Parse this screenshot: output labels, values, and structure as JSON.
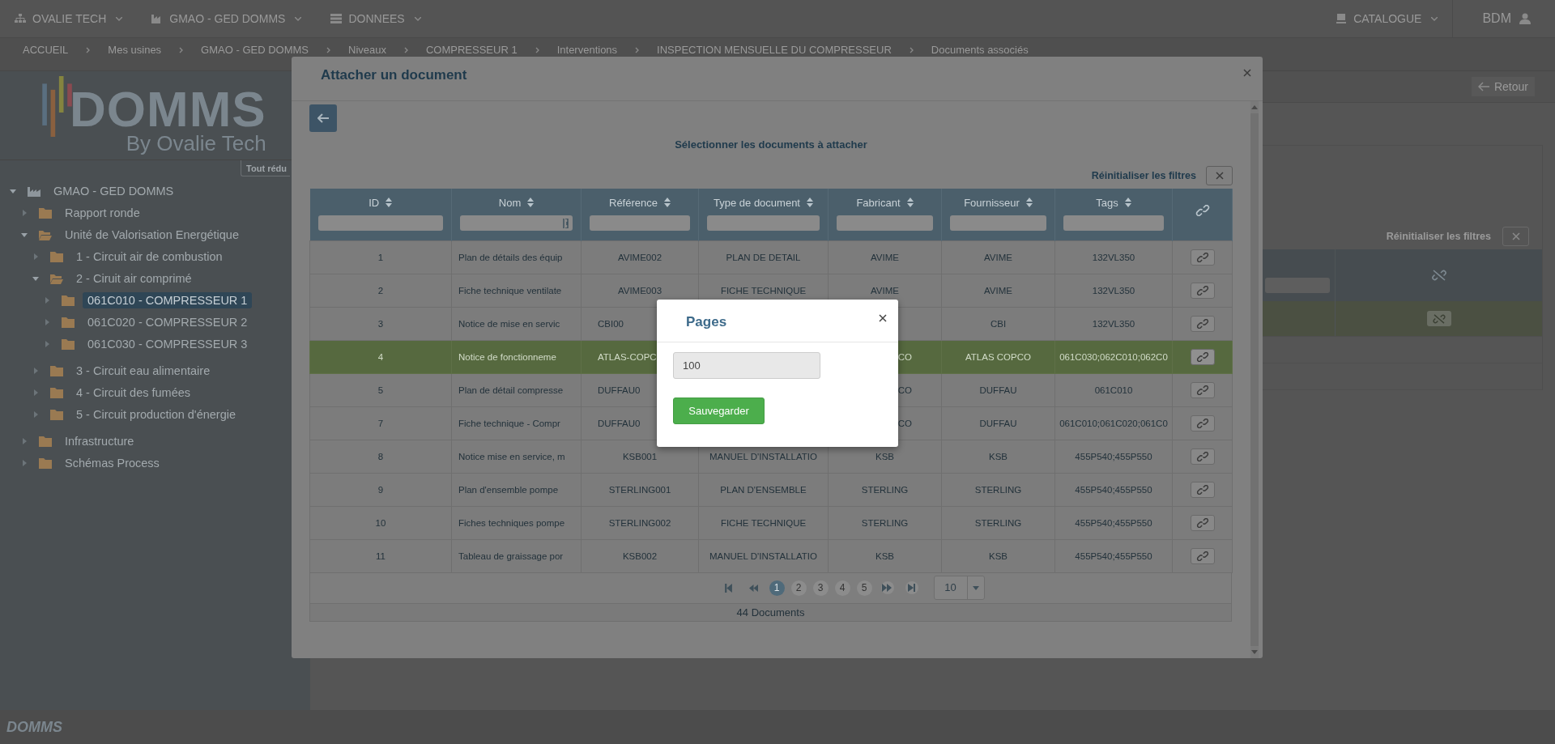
{
  "top_nav": {
    "menus": [
      {
        "label": "OVALIE TECH"
      },
      {
        "label": "GMAO - GED DOMMS"
      },
      {
        "label": "DONNEES"
      }
    ],
    "catalogue": "CATALOGUE",
    "user": "BDM"
  },
  "breadcrumb": [
    "ACCUEIL",
    "Mes usines",
    "GMAO - GED DOMMS",
    "Niveaux",
    "COMPRESSEUR 1",
    "Interventions",
    "INSPECTION MENSUELLE DU COMPRESSEUR",
    "Documents associés"
  ],
  "sidebar": {
    "logo": {
      "title": "DOMMS",
      "tagline": "By Ovalie Tech"
    },
    "collapse_button": "Tout rédu",
    "tree": [
      {
        "label": "GMAO - GED DOMMS",
        "expanded": true,
        "selected": false,
        "children": [
          {
            "label": "Rapport ronde",
            "expanded": false,
            "selected": false
          },
          {
            "label": "Unité de Valorisation Energétique",
            "expanded": true,
            "selected": false,
            "children": [
              {
                "label": "1 - Circuit air de combustion",
                "expanded": false,
                "selected": false
              },
              {
                "label": "2 - Ciruit air comprimé",
                "expanded": true,
                "selected": false,
                "children": [
                  {
                    "label": "061C010 - COMPRESSEUR 1",
                    "expanded": false,
                    "selected": true
                  },
                  {
                    "label": "061C020 - COMPRESSEUR 2",
                    "expanded": false,
                    "selected": false
                  },
                  {
                    "label": "061C030 - COMPRESSEUR 3",
                    "expanded": false,
                    "selected": false
                  }
                ]
              },
              {
                "label": "3 - Circuit eau alimentaire",
                "expanded": false,
                "selected": false
              },
              {
                "label": "4 - Circuit des fumées",
                "expanded": false,
                "selected": false
              },
              {
                "label": "5 - Circuit production d'énergie",
                "expanded": false,
                "selected": false
              }
            ]
          },
          {
            "label": "Infrastructure",
            "expanded": false,
            "selected": false
          },
          {
            "label": "Schémas Process",
            "expanded": false,
            "selected": false
          }
        ]
      }
    ]
  },
  "main": {
    "back_button": "Retour",
    "reset_filters": "Réinitialiser les filtres",
    "table": {
      "rows": [
        {
          "selected": true
        }
      ]
    }
  },
  "attach_modal": {
    "title": "Attacher un document",
    "subtitle": "Sélectionner les documents à attacher",
    "reset_filters": "Réinitialiser les filtres",
    "table": {
      "columns": [
        "ID",
        "Nom",
        "Référence",
        "Type de document",
        "Fabricant",
        "Fournisseur",
        "Tags"
      ],
      "rows": [
        {
          "selected": false,
          "cells": [
            "1",
            "Plan de détails des équip",
            "AVIME002",
            "PLAN DE DETAIL",
            "AVIME",
            "AVIME",
            "132VL350"
          ]
        },
        {
          "selected": false,
          "cells": [
            "2",
            "Fiche technique ventilate",
            "AVIME003",
            "FICHE TECHNIQUE",
            "AVIME",
            "AVIME",
            "132VL350"
          ]
        },
        {
          "selected": false,
          "cells": [
            "3",
            "Notice de mise en servic",
            {
              "text": "CBI00",
              "kind": "head"
            },
            null,
            null,
            "CBI",
            "132VL350"
          ]
        },
        {
          "selected": true,
          "cells": [
            "4",
            "Notice de fonctionneme",
            {
              "text": "ATLAS-COPC",
              "kind": "head"
            },
            null,
            {
              "text": "CO",
              "kind": "tail"
            },
            "ATLAS COPCO",
            "061C030;062C010;062C0"
          ]
        },
        {
          "selected": false,
          "cells": [
            "5",
            "Plan de détail compresse",
            {
              "text": "DUFFAU0",
              "kind": "head"
            },
            null,
            {
              "text": "CO",
              "kind": "tail"
            },
            "DUFFAU",
            "061C010"
          ]
        },
        {
          "selected": false,
          "cells": [
            "7",
            "Fiche technique - Compr",
            {
              "text": "DUFFAU0",
              "kind": "head"
            },
            null,
            {
              "text": "CO",
              "kind": "tail"
            },
            "DUFFAU",
            "061C010;061C020;061C0"
          ]
        },
        {
          "selected": false,
          "cells": [
            "8",
            "Notice mise en service, m",
            "KSB001",
            "MANUEL D'INSTALLATIO",
            "KSB",
            "KSB",
            "455P540;455P550"
          ]
        },
        {
          "selected": false,
          "cells": [
            "9",
            "Plan d'ensemble pompe",
            "STERLING001",
            "PLAN D'ENSEMBLE",
            "STERLING",
            "STERLING",
            "455P540;455P550"
          ]
        },
        {
          "selected": false,
          "cells": [
            "10",
            "Fiches techniques pompe",
            "STERLING002",
            "FICHE TECHNIQUE",
            "STERLING",
            "STERLING",
            "455P540;455P550"
          ]
        },
        {
          "selected": false,
          "cells": [
            "11",
            "Tableau de graissage por",
            "KSB002",
            "MANUEL D'INSTALLATIO",
            "KSB",
            "KSB",
            "455P540;455P550"
          ]
        }
      ]
    },
    "pagination": {
      "pages": [
        {
          "label": "1",
          "selected": true
        },
        {
          "label": "2",
          "selected": false
        },
        {
          "label": "3",
          "selected": false
        },
        {
          "label": "4",
          "selected": false
        },
        {
          "label": "5",
          "selected": false
        }
      ],
      "page_size": "10"
    },
    "footer": "44 Documents"
  },
  "pages_dialog": {
    "title": "Pages",
    "value": "100",
    "save_button": "Sauvegarder"
  },
  "footer": {
    "logo": "DOMMS"
  }
}
